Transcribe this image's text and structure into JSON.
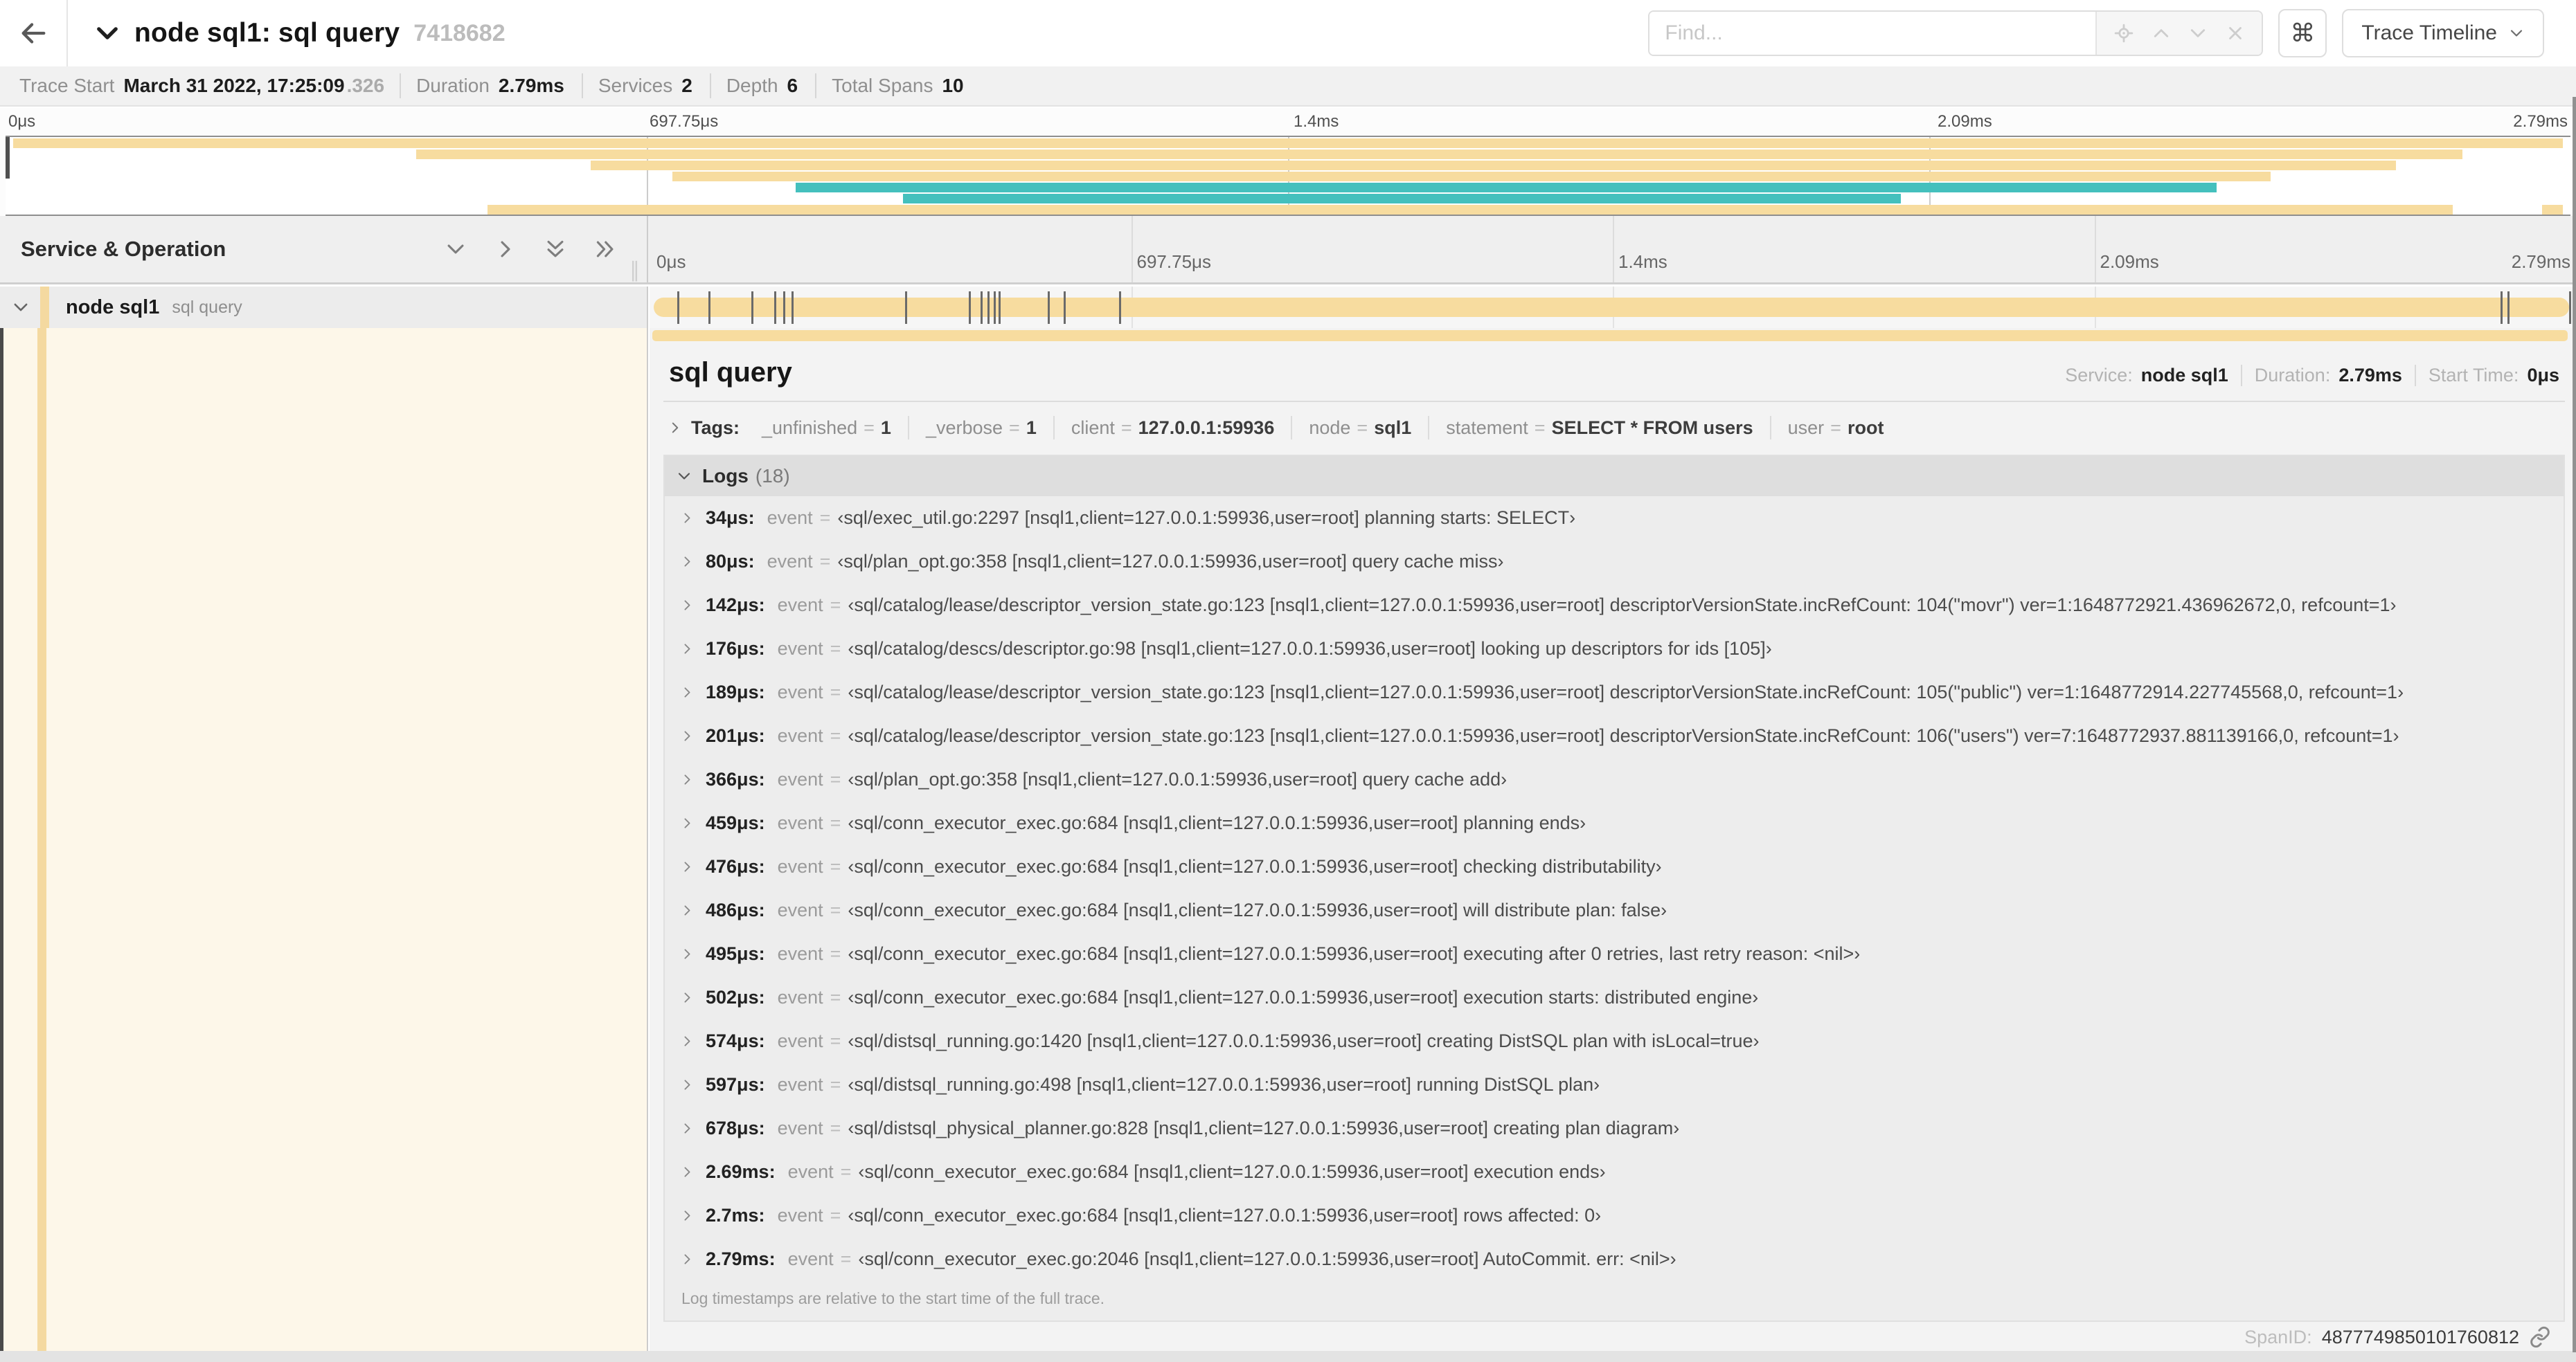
{
  "colors": {
    "tan": "#f7dc9f",
    "tan_light": "#f4d9a0",
    "teal": "#44c0bd",
    "selected_row": "#ececec",
    "cream": "#fdf7e9"
  },
  "header": {
    "title": "node sql1: sql query",
    "trace_id": "7418682",
    "find_placeholder": "Find...",
    "cmd_label": "⌘",
    "view_selector": "Trace Timeline"
  },
  "summary": {
    "items": [
      {
        "label": "Trace Start",
        "value": "March 31 2022, 17:25:09",
        "suffix": ".326"
      },
      {
        "label": "Duration",
        "value": "2.79ms"
      },
      {
        "label": "Services",
        "value": "2"
      },
      {
        "label": "Depth",
        "value": "6"
      },
      {
        "label": "Total Spans",
        "value": "10"
      }
    ]
  },
  "minimap": {
    "ticks": [
      "0μs",
      "697.75μs",
      "1.4ms",
      "2.09ms",
      "2.79ms"
    ],
    "spans": [
      {
        "row": 0,
        "x": 0.3,
        "w": 99.4,
        "color": "tan"
      },
      {
        "row": 1,
        "x": 16.0,
        "w": 79.8,
        "color": "tan"
      },
      {
        "row": 2,
        "x": 22.8,
        "w": 70.4,
        "color": "tan"
      },
      {
        "row": 3,
        "x": 26.0,
        "w": 62.3,
        "color": "tan"
      },
      {
        "row": 4,
        "x": 30.8,
        "w": 55.4,
        "color": "teal"
      },
      {
        "row": 5,
        "x": 35.0,
        "w": 38.9,
        "color": "teal"
      },
      {
        "row": 6,
        "x": 18.8,
        "w": 76.6,
        "color": "tan"
      },
      {
        "row": 6,
        "x": 98.9,
        "w": 0.8,
        "color": "tan"
      }
    ]
  },
  "timeline": {
    "left_header": "Service & Operation",
    "ticks": [
      "0μs",
      "697.75μs",
      "1.4ms",
      "2.09ms",
      "2.79ms"
    ],
    "duration_us": 2790,
    "row": {
      "service": "node sql1",
      "operation": "sql query"
    },
    "log_marks_us": [
      34,
      80,
      142,
      176,
      189,
      201,
      366,
      459,
      476,
      486,
      495,
      502,
      574,
      597,
      678,
      2690,
      2700,
      2790
    ]
  },
  "detail": {
    "operation": "sql query",
    "meta": [
      {
        "label": "Service:",
        "value": "node sql1"
      },
      {
        "label": "Duration:",
        "value": "2.79ms"
      },
      {
        "label": "Start Time:",
        "value": "0μs"
      }
    ],
    "tags_label": "Tags:",
    "tags": [
      {
        "key": "_unfinished",
        "value": "1"
      },
      {
        "key": "_verbose",
        "value": "1"
      },
      {
        "key": "client",
        "value": "127.0.0.1:59936"
      },
      {
        "key": "node",
        "value": "sql1"
      },
      {
        "key": "statement",
        "value": "SELECT * FROM users"
      },
      {
        "key": "user",
        "value": "root"
      }
    ],
    "logs_label": "Logs",
    "logs_count": "(18)",
    "event_key": "event",
    "logs": [
      {
        "time": "34μs:",
        "msg": "‹sql/exec_util.go:2297 [nsql1,client=127.0.0.1:59936,user=root] planning starts: SELECT›"
      },
      {
        "time": "80μs:",
        "msg": "‹sql/plan_opt.go:358 [nsql1,client=127.0.0.1:59936,user=root] query cache miss›"
      },
      {
        "time": "142μs:",
        "msg": "‹sql/catalog/lease/descriptor_version_state.go:123 [nsql1,client=127.0.0.1:59936,user=root] descriptorVersionState.incRefCount: 104(\"movr\") ver=1:1648772921.436962672,0, refcount=1›"
      },
      {
        "time": "176μs:",
        "msg": "‹sql/catalog/descs/descriptor.go:98 [nsql1,client=127.0.0.1:59936,user=root] looking up descriptors for ids [105]›"
      },
      {
        "time": "189μs:",
        "msg": "‹sql/catalog/lease/descriptor_version_state.go:123 [nsql1,client=127.0.0.1:59936,user=root] descriptorVersionState.incRefCount: 105(\"public\") ver=1:1648772914.227745568,0, refcount=1›"
      },
      {
        "time": "201μs:",
        "msg": "‹sql/catalog/lease/descriptor_version_state.go:123 [nsql1,client=127.0.0.1:59936,user=root] descriptorVersionState.incRefCount: 106(\"users\") ver=7:1648772937.881139166,0, refcount=1›"
      },
      {
        "time": "366μs:",
        "msg": "‹sql/plan_opt.go:358 [nsql1,client=127.0.0.1:59936,user=root] query cache add›"
      },
      {
        "time": "459μs:",
        "msg": "‹sql/conn_executor_exec.go:684 [nsql1,client=127.0.0.1:59936,user=root] planning ends›"
      },
      {
        "time": "476μs:",
        "msg": "‹sql/conn_executor_exec.go:684 [nsql1,client=127.0.0.1:59936,user=root] checking distributability›"
      },
      {
        "time": "486μs:",
        "msg": "‹sql/conn_executor_exec.go:684 [nsql1,client=127.0.0.1:59936,user=root] will distribute plan: false›"
      },
      {
        "time": "495μs:",
        "msg": "‹sql/conn_executor_exec.go:684 [nsql1,client=127.0.0.1:59936,user=root] executing after 0 retries, last retry reason: <nil>›"
      },
      {
        "time": "502μs:",
        "msg": "‹sql/conn_executor_exec.go:684 [nsql1,client=127.0.0.1:59936,user=root] execution starts: distributed engine›"
      },
      {
        "time": "574μs:",
        "msg": "‹sql/distsql_running.go:1420 [nsql1,client=127.0.0.1:59936,user=root] creating DistSQL plan with isLocal=true›"
      },
      {
        "time": "597μs:",
        "msg": "‹sql/distsql_running.go:498 [nsql1,client=127.0.0.1:59936,user=root] running DistSQL plan›"
      },
      {
        "time": "678μs:",
        "msg": "‹sql/distsql_physical_planner.go:828 [nsql1,client=127.0.0.1:59936,user=root] creating plan diagram›"
      },
      {
        "time": "2.69ms:",
        "msg": "‹sql/conn_executor_exec.go:684 [nsql1,client=127.0.0.1:59936,user=root] execution ends›"
      },
      {
        "time": "2.7ms:",
        "msg": "‹sql/conn_executor_exec.go:684 [nsql1,client=127.0.0.1:59936,user=root] rows affected: 0›"
      },
      {
        "time": "2.79ms:",
        "msg": "‹sql/conn_executor_exec.go:2046 [nsql1,client=127.0.0.1:59936,user=root] AutoCommit. err: <nil>›"
      }
    ],
    "logs_footer": "Log timestamps are relative to the start time of the full trace.",
    "spanid_label": "SpanID:",
    "spanid_value": "4877749850101760812"
  }
}
